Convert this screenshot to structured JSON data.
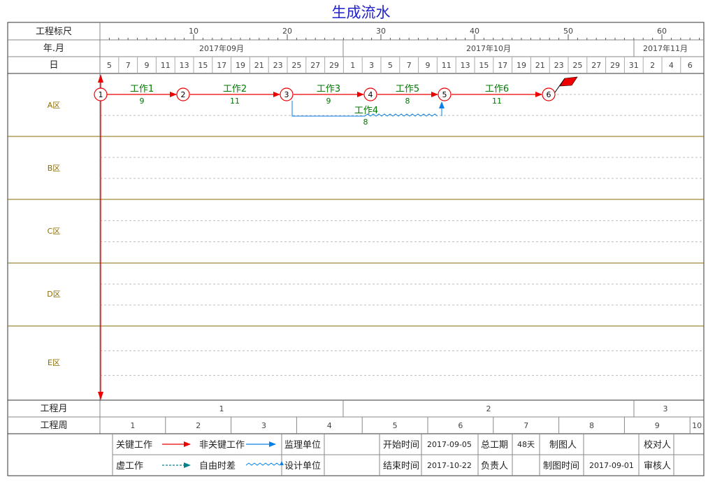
{
  "title": "生成流水",
  "row_labels": {
    "ruler": "工程标尺",
    "month": "年.月",
    "day": "日",
    "project_month": "工程月",
    "project_week": "工程周"
  },
  "ruler_ticks": [
    "10",
    "20",
    "30",
    "40",
    "50",
    "60"
  ],
  "months": [
    "2017年09月",
    "2017年10月",
    "2017年11月"
  ],
  "days": [
    "5",
    "7",
    "9",
    "11",
    "13",
    "15",
    "17",
    "19",
    "21",
    "23",
    "25",
    "27",
    "29",
    "1",
    "3",
    "5",
    "7",
    "9",
    "11",
    "13",
    "15",
    "17",
    "19",
    "21",
    "23",
    "25",
    "27",
    "29",
    "31",
    "2",
    "4",
    "6"
  ],
  "zones": [
    "A区",
    "B区",
    "C区",
    "D区",
    "E区"
  ],
  "project_months": [
    "1",
    "2",
    "3"
  ],
  "project_weeks": [
    "1",
    "2",
    "3",
    "4",
    "5",
    "6",
    "7",
    "8",
    "9",
    "10"
  ],
  "nodes": [
    "1",
    "2",
    "3",
    "4",
    "5",
    "6"
  ],
  "tasks": [
    {
      "name": "工作1",
      "duration": "9"
    },
    {
      "name": "工作2",
      "duration": "11"
    },
    {
      "name": "工作3",
      "duration": "9"
    },
    {
      "name": "工作5",
      "duration": "8"
    },
    {
      "name": "工作6",
      "duration": "11"
    },
    {
      "name": "工作4",
      "duration": "8"
    }
  ],
  "colors": {
    "critical": "#ee0000",
    "noncritical": "#0a7fe6",
    "dummy": "#00808a",
    "grid": "#8a6d00",
    "label_olive": "#8a6d00",
    "task_label": "#007700"
  },
  "legend": {
    "critical": "关键工作",
    "noncritical": "非关键工作",
    "dummy": "虚工作",
    "free_float": "自由时差",
    "supervisor": "监理单位",
    "designer": "设计单位"
  },
  "info": {
    "start_label": "开始时间",
    "start": "2017-09-05",
    "end_label": "结束时间",
    "end": "2017-10-22",
    "duration_label": "总工期",
    "duration": "48天",
    "owner_label": "负责人",
    "drawer_label": "制图人",
    "draw_date_label": "制图时间",
    "draw_date": "2017-09-01",
    "checker_label": "校对人",
    "reviewer_label": "审核人"
  }
}
